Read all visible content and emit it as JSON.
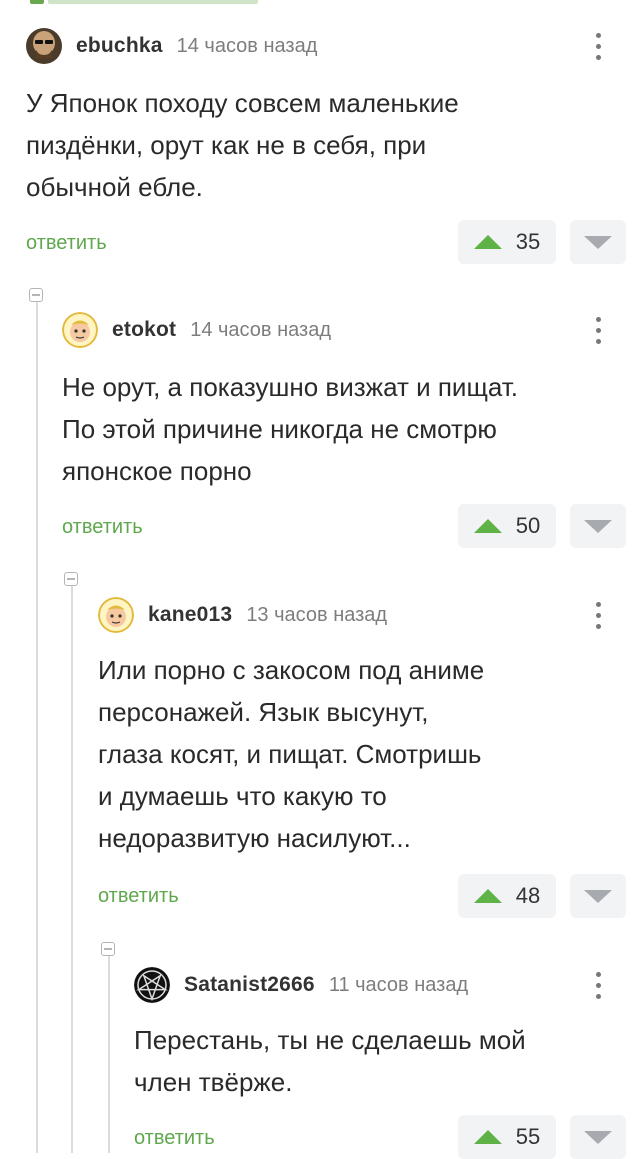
{
  "reply_label": "ответить",
  "comments": [
    {
      "author": "ebuchka",
      "time": "14 часов назад",
      "text": [
        "У Японок походу совсем маленькие",
        "пиздёнки, орут как не в себя, при",
        "обычной ебле."
      ],
      "score": "35"
    },
    {
      "author": "etokot",
      "time": "14 часов назад",
      "text": [
        "Не орут, а показушно визжат и пищат.",
        "По этой причине никогда не смотрю",
        "японское порно"
      ],
      "score": "50"
    },
    {
      "author": "kane013",
      "time": "13 часов назад",
      "text": [
        "Или порно с закосом под аниме",
        "персонажей. Язык высунут,",
        "глаза косят, и пищат. Смотришь",
        "и думаешь что какую то",
        "недоразвитую насилуют..."
      ],
      "score": "48"
    },
    {
      "author": "Satanist2666",
      "time": "11 часов назад",
      "text": [
        "Перестань, ты не сделаешь мой",
        "член твёрже."
      ],
      "score": "55"
    }
  ],
  "colors": {
    "accent": "#5fa84d",
    "upvote": "#5fb346",
    "vote_bg": "#f2f3f4"
  }
}
